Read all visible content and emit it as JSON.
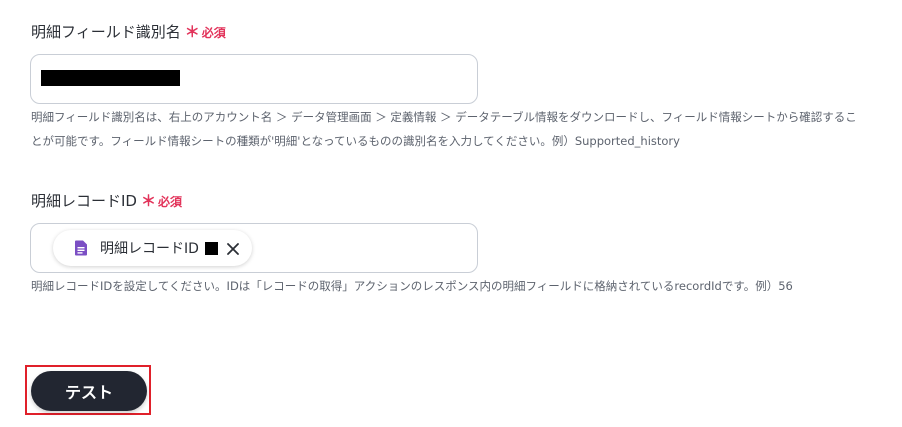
{
  "field1": {
    "label": "明細フィールド識別名",
    "required_mark": "＊",
    "required_text": "必須",
    "help_line1": "明細フィールド識別名は、右上のアカウント名 ＞ データ管理画面 ＞ 定義情報 ＞ データテーブル情報をダウンロードし、フィールド情報シートから確認するこ",
    "help_line2": "とが可能です。フィールド情報シートの種類が'明細'となっているものの識別名を入力してください。例）Supported_history"
  },
  "field2": {
    "label": "明細レコードID",
    "required_mark": "＊",
    "required_text": "必須",
    "chip_label": "明細レコードID",
    "chip_icon": "document-icon",
    "chip_icon_color": "#7b4fc4",
    "help_line1": "明細レコードIDを設定してください。IDは「レコードの取得」アクションのレスポンス内の明細フィールドに格納されているrecordIdです。例）56"
  },
  "actions": {
    "test_label": "テスト"
  },
  "colors": {
    "required": "#e2335a",
    "button_bg": "#222631",
    "highlight_border": "#e0202a"
  }
}
